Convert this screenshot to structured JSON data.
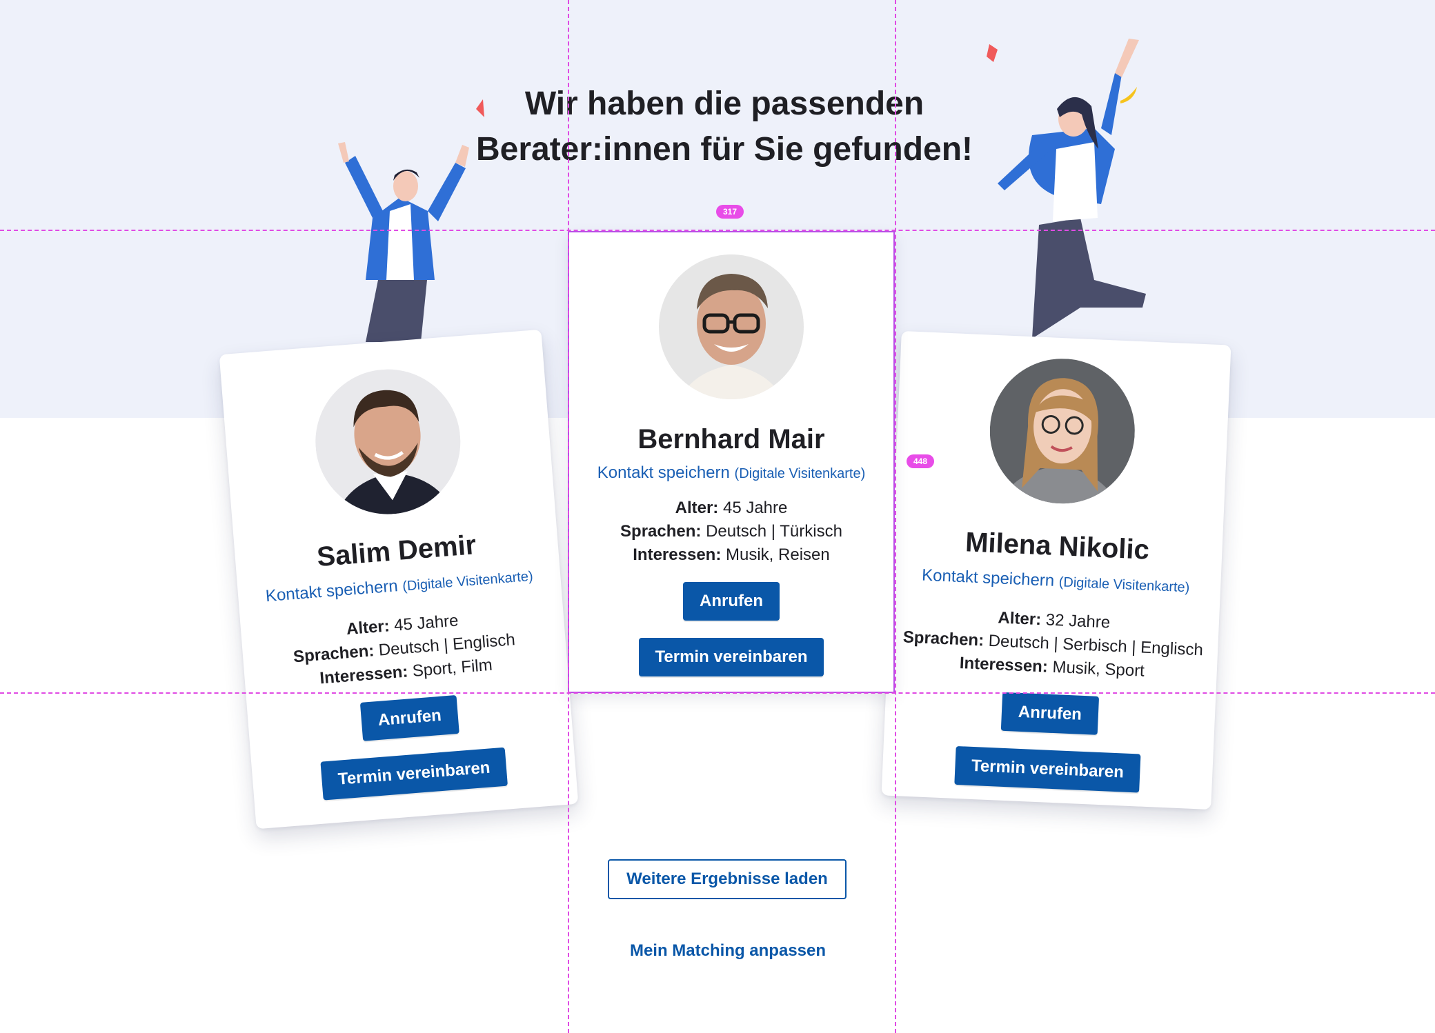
{
  "header": {
    "headline_line1": "Wir haben die passenden",
    "headline_line2": "Berater:innen für Sie gefunden!"
  },
  "measurements": {
    "top_gap_label": "317",
    "side_gap_label": "448"
  },
  "advisors": [
    {
      "name": "Salim Demir",
      "contact_link": "Kontakt speichern",
      "contact_note": "(Digitale Visitenkarte)",
      "age_label": "Alter:",
      "age": "45 Jahre",
      "languages_label": "Sprachen:",
      "languages": "Deutsch | Englisch",
      "interests_label": "Interessen:",
      "interests": "Sport, Film",
      "call_label": "Anrufen",
      "appointment_label": "Termin vereinbaren"
    },
    {
      "name": "Bernhard Mair",
      "contact_link": "Kontakt speichern",
      "contact_note": "(Digitale Visitenkarte)",
      "age_label": "Alter:",
      "age": "45 Jahre",
      "languages_label": "Sprachen:",
      "languages": "Deutsch | Türkisch",
      "interests_label": "Interessen:",
      "interests": "Musik, Reisen",
      "call_label": "Anrufen",
      "appointment_label": "Termin vereinbaren"
    },
    {
      "name": "Milena Nikolic",
      "contact_link": "Kontakt speichern",
      "contact_note": "(Digitale Visitenkarte)",
      "age_label": "Alter:",
      "age": "32 Jahre",
      "languages_label": "Sprachen:",
      "languages": "Deutsch | Serbisch | Englisch",
      "interests_label": "Interessen:",
      "interests": "Musik, Sport",
      "call_label": "Anrufen",
      "appointment_label": "Termin vereinbaren"
    }
  ],
  "actions": {
    "load_more_label": "Weitere Ergebnisse laden",
    "adjust_matching_label": "Mein Matching anpassen"
  },
  "colors": {
    "brand_blue": "#0a57a8",
    "link_blue": "#1a5fb4",
    "hero_background": "#eef1fa",
    "guide_magenta": "#e04be4",
    "illustration_blue": "#2f6fd6"
  },
  "icons": [
    "confetti-icon",
    "jumping-man-illustration",
    "jumping-woman-illustration"
  ]
}
